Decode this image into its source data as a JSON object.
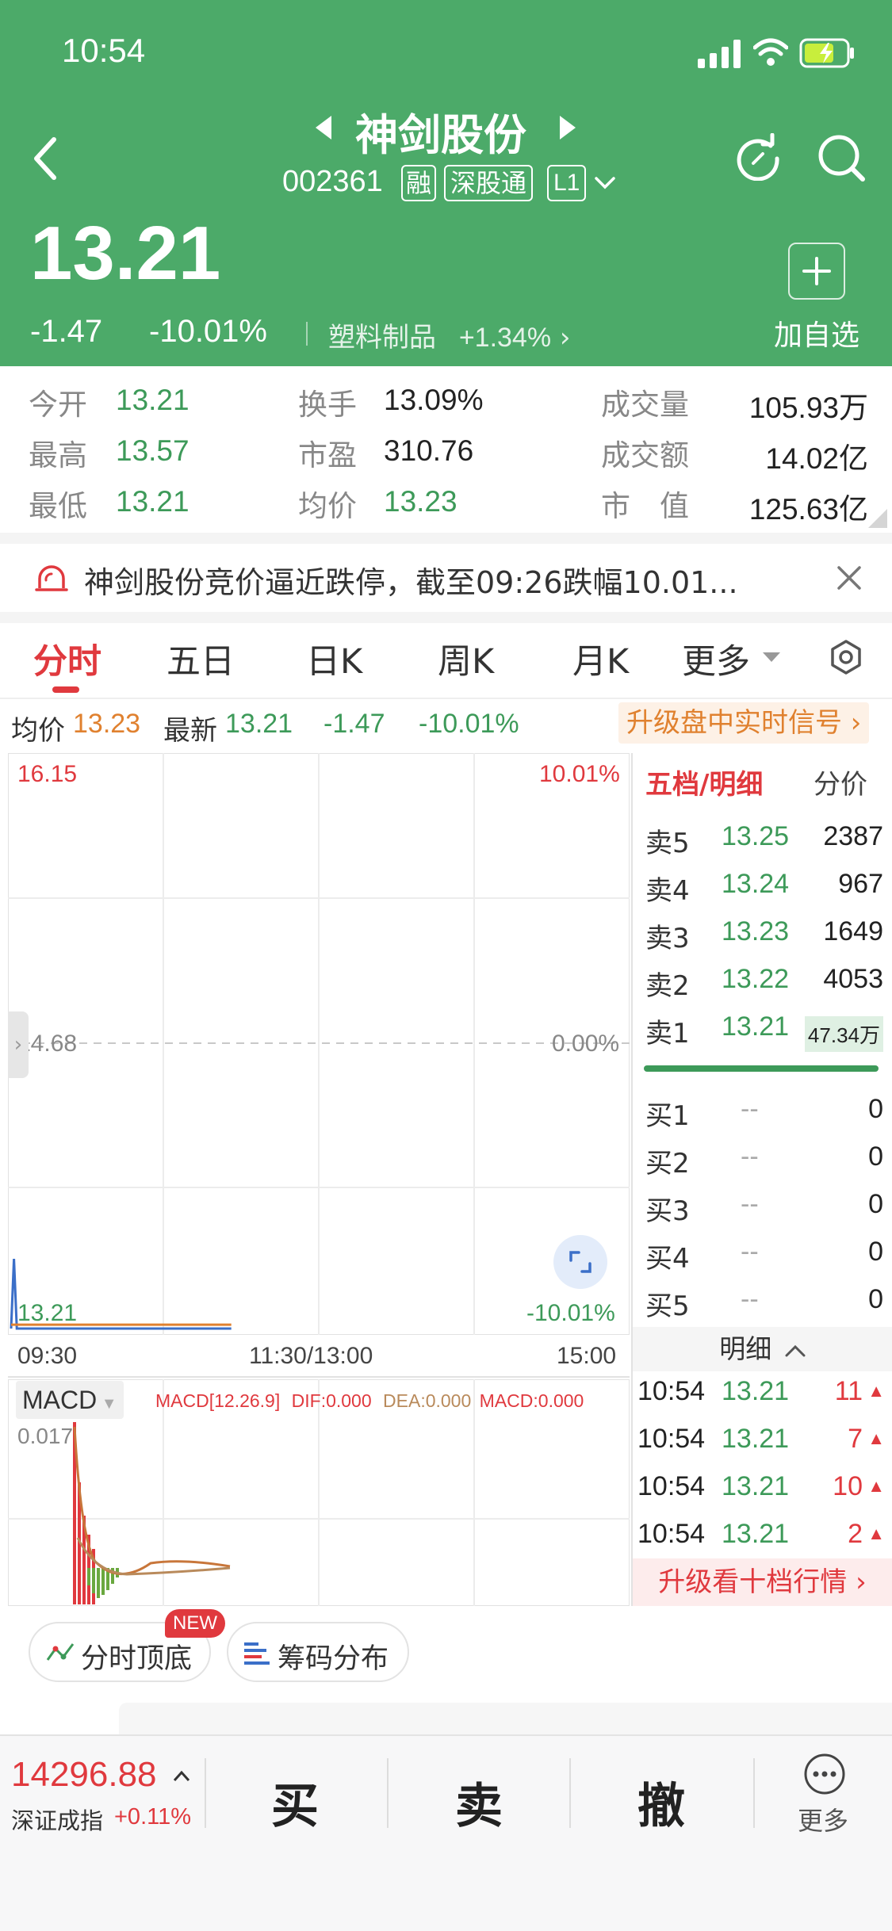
{
  "status_bar": {
    "time": "10:54"
  },
  "header": {
    "stock_name": "神剑股份",
    "code": "002361",
    "tags": [
      "融",
      "深股通",
      "L1"
    ],
    "price": "13.21",
    "change": "-1.47",
    "change_pct": "-10.01%",
    "sector": "塑料制品",
    "sector_change": "+1.34%",
    "add_watchlist": "加自选"
  },
  "stats": [
    {
      "label": "今开",
      "value": "13.21"
    },
    {
      "label": "换手",
      "value": "13.09%"
    },
    {
      "label": "成交量",
      "value": "105.93万"
    },
    {
      "label": "最高",
      "value": "13.57"
    },
    {
      "label": "市盈",
      "value": "310.76"
    },
    {
      "label": "成交额",
      "value": "14.02亿"
    },
    {
      "label": "最低",
      "value": "13.21"
    },
    {
      "label": "均价",
      "value": "13.23"
    },
    {
      "label": "市　值",
      "value": "125.63亿"
    }
  ],
  "notice": {
    "text": "神剑股份竞价逼近跌停，截至09:26跌幅10.01..."
  },
  "tabs": [
    "分时",
    "五日",
    "日K",
    "周K",
    "月K",
    "更多"
  ],
  "info_bar": {
    "avg_label": "均价",
    "avg_value": "13.23",
    "latest_label": "最新",
    "latest_value": "13.21",
    "change": "-1.47",
    "change_pct": "-10.01%",
    "upgrade": "升级盘中实时信号"
  },
  "chart_labels": {
    "price_top": "16.15",
    "price_mid": "14.68",
    "price_bottom": "13.21",
    "pct_top": "10.01%",
    "pct_mid": "0.00%",
    "pct_bottom": "-10.01%",
    "time_start": "09:30",
    "time_mid": "11:30/13:00",
    "time_end": "15:00"
  },
  "chart_data": {
    "type": "line",
    "x": [
      "09:30",
      "09:31",
      "09:32",
      "09:33",
      "09:34",
      "09:35"
    ],
    "series": [
      {
        "values": [
          13.21,
          13.57,
          13.21,
          13.21,
          13.21,
          13.21
        ]
      },
      {
        "values": [
          13.23,
          13.23,
          13.23,
          13.23,
          13.23,
          13.23
        ]
      }
    ],
    "ylim": [
      13.21,
      16.15
    ],
    "grid": true
  },
  "macd": {
    "selector": "MACD",
    "params": "MACD[12.26.9]",
    "dif": "DIF:0.000",
    "dea": "DEA:0.000",
    "macd": "MACD:0.000",
    "top_value": "0.017"
  },
  "orderbook": {
    "title": "五档/明细",
    "alt_tab": "分价",
    "sells": [
      {
        "label": "卖5",
        "price": "13.25",
        "volume": "2387"
      },
      {
        "label": "卖4",
        "price": "13.24",
        "volume": "967"
      },
      {
        "label": "卖3",
        "price": "13.23",
        "volume": "1649"
      },
      {
        "label": "卖2",
        "price": "13.22",
        "volume": "4053"
      },
      {
        "label": "卖1",
        "price": "13.21",
        "volume": "47.34万"
      }
    ],
    "buys": [
      {
        "label": "买1",
        "price": "--",
        "volume": "0"
      },
      {
        "label": "买2",
        "price": "--",
        "volume": "0"
      },
      {
        "label": "买3",
        "price": "--",
        "volume": "0"
      },
      {
        "label": "买4",
        "price": "--",
        "volume": "0"
      },
      {
        "label": "买5",
        "price": "--",
        "volume": "0"
      }
    ],
    "detail_label": "明细",
    "ticks": [
      {
        "time": "10:54",
        "price": "13.21",
        "volume": "11"
      },
      {
        "time": "10:54",
        "price": "13.21",
        "volume": "7"
      },
      {
        "time": "10:54",
        "price": "13.21",
        "volume": "10"
      },
      {
        "time": "10:54",
        "price": "13.21",
        "volume": "2"
      }
    ],
    "upgrade_ten": "升级看十档行情"
  },
  "features": [
    {
      "label": "分时顶底",
      "badge": "NEW"
    },
    {
      "label": "筹码分布"
    }
  ],
  "bottom_bar": {
    "index_value": "14296.88",
    "index_name": "深证成指",
    "index_change": "+0.11%",
    "buy": "买",
    "sell": "卖",
    "cancel": "撤",
    "more": "更多"
  },
  "colors": {
    "header_green": "#4caa69",
    "up_red": "#e0393e",
    "down_green": "#3d9a59",
    "avg_orange": "#e0812f"
  }
}
